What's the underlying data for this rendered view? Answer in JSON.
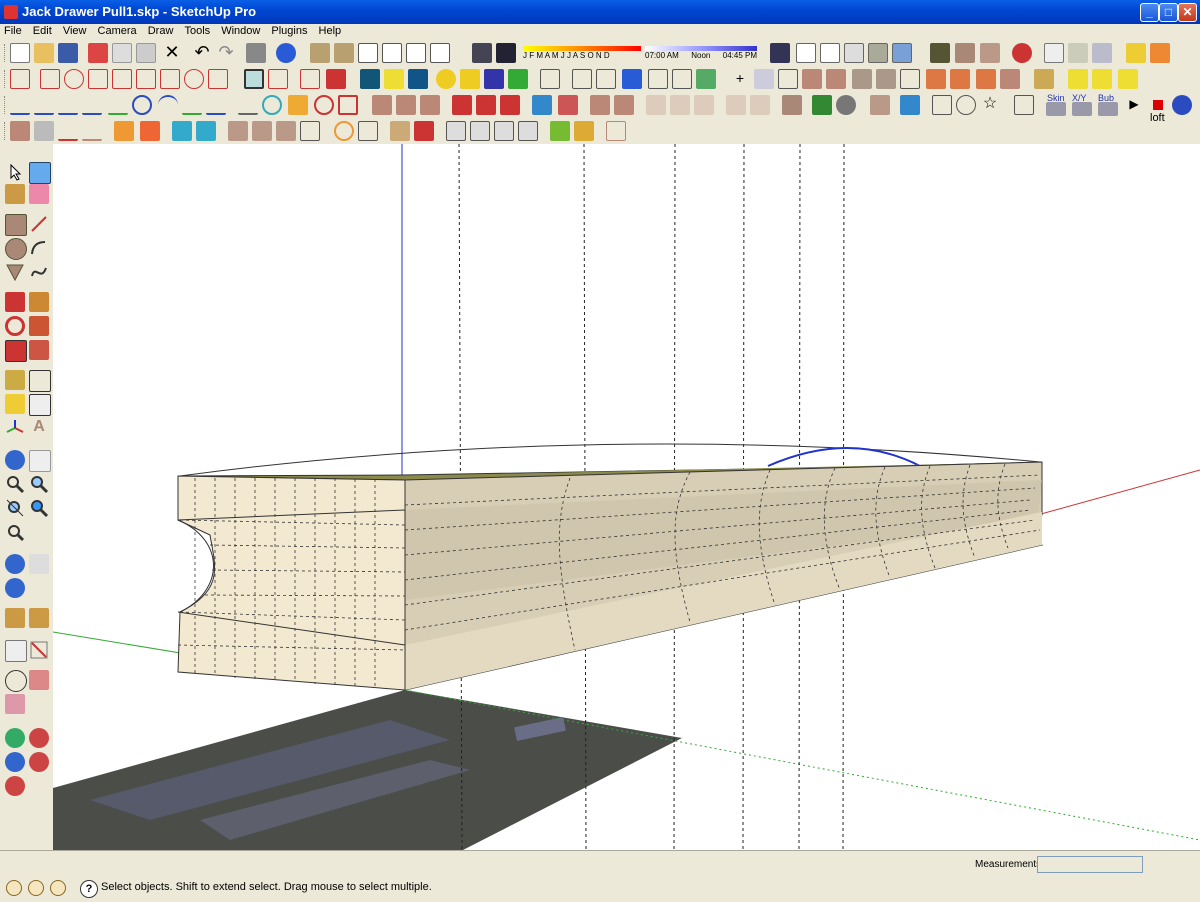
{
  "window": {
    "title": "Jack Drawer Pull1.skp - SketchUp Pro",
    "minimize": "_",
    "maximize": "□",
    "close": "✕"
  },
  "menu": [
    "File",
    "Edit",
    "View",
    "Camera",
    "Draw",
    "Tools",
    "Window",
    "Plugins",
    "Help"
  ],
  "shadow_settings": {
    "months": "J F M A M J J A S O N D",
    "time_start": "07:00 AM",
    "time_mid": "Noon",
    "time_end": "04:45 PM"
  },
  "toolbar_text": {
    "loft": "loft",
    "skin": "Skin",
    "xyz": "X/Y",
    "bub": "Bub"
  },
  "status": {
    "hint": "Select objects. Shift to extend select. Drag mouse to select multiple.",
    "measurements_label": "Measurements",
    "measurements_value": ""
  },
  "colors": {
    "model_face": "#e3d9c2",
    "model_top": "#8b8a4c",
    "shadow": "#4a4d48",
    "axis_red": "#cc3333",
    "axis_green": "#33aa33",
    "axis_blue": "#2233cc"
  },
  "icons": [
    "select-icon",
    "component-icon",
    "paint-bucket-icon",
    "eraser-icon",
    "rectangle-icon",
    "line-icon",
    "circle-icon",
    "arc-icon",
    "polygon-icon",
    "freehand-icon",
    "move-icon",
    "push-pull-icon",
    "rotate-icon",
    "follow-me-icon",
    "scale-icon",
    "offset-icon",
    "tape-measure-icon",
    "dimension-icon",
    "protractor-icon",
    "text-icon",
    "axes-icon",
    "3d-text-icon",
    "orbit-icon",
    "pan-icon",
    "zoom-icon",
    "zoom-window-icon",
    "zoom-extents-icon",
    "previous-view-icon",
    "position-camera-icon",
    "walk-icon",
    "look-around-icon",
    "section-plane-icon"
  ]
}
